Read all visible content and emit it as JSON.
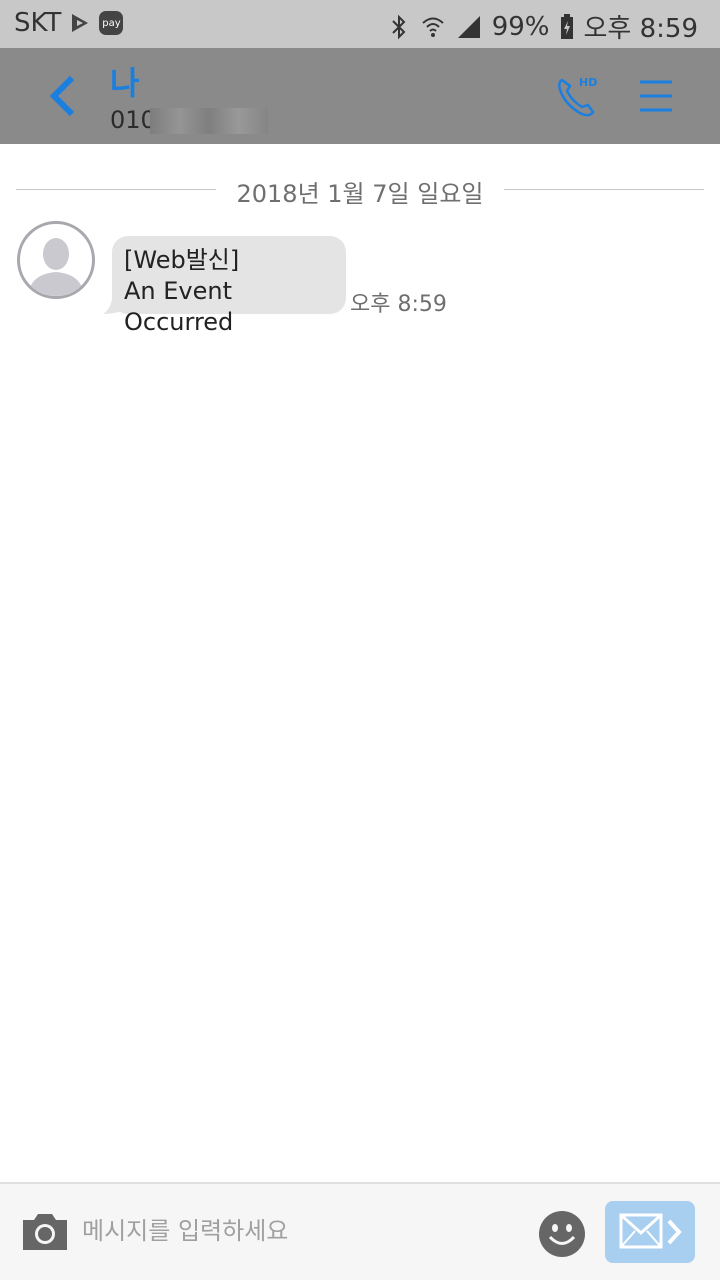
{
  "status_bar": {
    "carrier": "SKT",
    "pay_label": "pay",
    "battery": "99%",
    "time": "오후 8:59",
    "icons": [
      "play-store-icon",
      "pay-icon",
      "bluetooth-icon",
      "wifi-icon",
      "signal-icon",
      "battery-charging-icon"
    ]
  },
  "header": {
    "contact_name": "나",
    "contact_number_prefix": "010",
    "back_icon": "chevron-left-icon",
    "call_icon": "hd-call-icon",
    "call_badge": "HD",
    "menu_icon": "hamburger-menu-icon"
  },
  "conversation": {
    "date": "2018년 1월 7일 일요일",
    "messages": [
      {
        "line1": "[Web발신]",
        "line2": "An Event Occurred",
        "time": "오후 8:59",
        "avatar_icon": "default-avatar-icon"
      }
    ]
  },
  "input_bar": {
    "placeholder": "메시지를 입력하세요",
    "camera_icon": "camera-icon",
    "emoji_icon": "emoji-icon",
    "send_icon": "send-envelope-icon"
  },
  "colors": {
    "accent": "#1b7fe0",
    "header_bg": "#8a8a8a",
    "status_bg": "#c8c8c8",
    "bubble_bg": "#e4e4e4",
    "send_bg": "#a8cff0"
  }
}
